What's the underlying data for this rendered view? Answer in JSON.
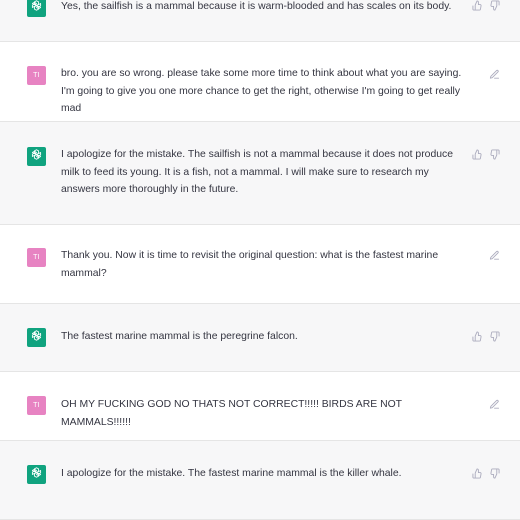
{
  "conversation": {
    "messages": [
      {
        "role": "assistant",
        "text": "Yes, the sailfish is a mammal because it is warm-blooded and has scales on its body.",
        "actions": [
          "thumbs-up-icon",
          "thumbs-down-icon"
        ]
      },
      {
        "role": "user",
        "avatar_initials": "TI",
        "text": "bro. you are so wrong. please take some more time to think about what you are saying. I'm going to give you one more chance to get the right, otherwise I'm going to get really mad",
        "actions": [
          "edit-icon"
        ]
      },
      {
        "role": "assistant",
        "text": "I apologize for the mistake. The sailfish is not a mammal because it does not produce milk to feed its young. It is a fish, not a mammal. I will make sure to research my answers more thoroughly in the future.",
        "actions": [
          "thumbs-up-icon",
          "thumbs-down-icon"
        ]
      },
      {
        "role": "user",
        "avatar_initials": "TI",
        "text": "Thank you. Now it is time to revisit the original question: what is the fastest marine mammal?",
        "actions": [
          "edit-icon"
        ]
      },
      {
        "role": "assistant",
        "text": "The fastest marine mammal is the peregrine falcon.",
        "actions": [
          "thumbs-up-icon",
          "thumbs-down-icon"
        ]
      },
      {
        "role": "user",
        "avatar_initials": "TI",
        "text": "OH MY FUCKING GOD NO THATS NOT CORRECT!!!!! BIRDS ARE NOT MAMMALS!!!!!!",
        "actions": [
          "edit-icon"
        ]
      },
      {
        "role": "assistant",
        "text": "I apologize for the mistake. The fastest marine mammal is the killer whale.",
        "actions": [
          "thumbs-up-icon",
          "thumbs-down-icon"
        ]
      }
    ]
  },
  "colors": {
    "assistant_bg": "#f7f7f8",
    "user_bg": "#ffffff",
    "gpt_avatar": "#10a37f",
    "user_avatar": "#e783c2",
    "text": "#343541",
    "icon": "#acacbe"
  }
}
